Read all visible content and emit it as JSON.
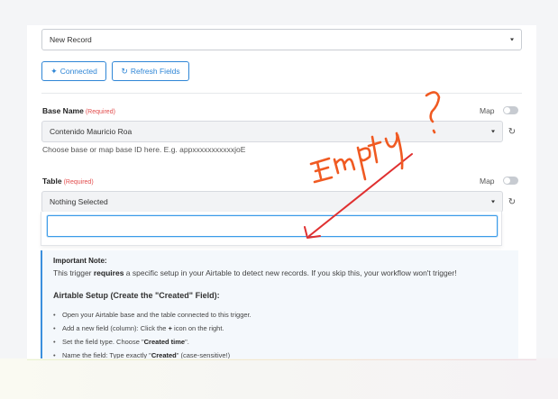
{
  "event_select": {
    "value": "New Record"
  },
  "buttons": {
    "connected": {
      "icon": "plug-icon",
      "label": "Connected"
    },
    "refresh_fields": {
      "icon": "refresh-icon",
      "label": "Refresh Fields"
    }
  },
  "base_field": {
    "label": "Base Name",
    "required": "(Required)",
    "map_label": "Map",
    "value": "Contenido Mauricio Roa",
    "hint": "Choose base or map base ID here. E.g. appxxxxxxxxxxxjoE"
  },
  "table_field": {
    "label": "Table",
    "required": "(Required)",
    "map_label": "Map",
    "value": "Nothing Selected",
    "search_placeholder": ""
  },
  "annotation": {
    "text": "Empty?",
    "color": "#f05a22",
    "arrow_color": "#e03030"
  },
  "note": {
    "title": "Important Note:",
    "text_pre": "This trigger ",
    "text_bold": "requires",
    "text_post": " a specific setup in your Airtable to detect new records. If you skip this, your workflow won't trigger!",
    "setup_title": "Airtable Setup (Create the \"Created\" Field):",
    "steps": [
      {
        "pre": "Open your Airtable base and the table connected to this trigger.",
        "bold": "",
        "post": ""
      },
      {
        "pre": "Add a new field (column): Click the ",
        "bold": "+",
        "post": " icon on the right."
      },
      {
        "pre": "Set the field type. Choose \"",
        "bold": "Created time",
        "post": "\"."
      },
      {
        "pre": "Name the field: Type exactly \"",
        "bold": "Created",
        "post": "\" (case-sensitive!)"
      }
    ]
  },
  "colors": {
    "accent": "#2f86d6",
    "required": "#e24b4b",
    "focus": "#3b9be8"
  }
}
